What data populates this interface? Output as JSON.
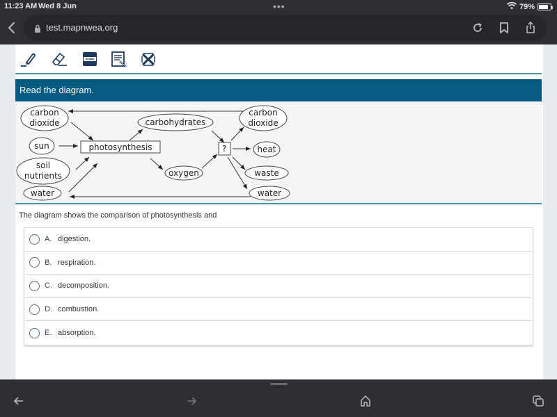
{
  "status_bar": {
    "time": "11:23 AM",
    "date": "Wed 8 Jun",
    "dots": "•••",
    "battery_percent": "79%",
    "battery_level": 0.79
  },
  "browser": {
    "url": "test.mapnwea.org",
    "icons": [
      "back-chevron-icon",
      "lock-icon",
      "reload-icon",
      "bookmark-icon",
      "share-icon"
    ]
  },
  "toolbar": {
    "tools": [
      {
        "name": "highlighter",
        "icon": "highlighter-icon"
      },
      {
        "name": "eraser",
        "icon": "eraser-icon"
      },
      {
        "name": "line-reader",
        "icon": "line-reader-icon"
      },
      {
        "name": "notepad",
        "icon": "notepad-icon"
      },
      {
        "name": "answer-eliminator",
        "icon": "answer-eliminator-icon"
      }
    ]
  },
  "prompt": {
    "banner_text": "Read the diagram."
  },
  "diagram": {
    "nodes": {
      "carbon_dioxide_in": [
        "carbon",
        "dioxide"
      ],
      "sun": "sun",
      "soil_nutrients": [
        "soil",
        "nutrients"
      ],
      "water_in": "water",
      "photosynthesis": "photosynthesis",
      "carbohydrates": "carbohydrates",
      "oxygen": "oxygen",
      "unknown": "?",
      "carbon_dioxide_out": [
        "carbon",
        "dioxide"
      ],
      "heat": "heat",
      "waste": "waste",
      "water_out": "water"
    }
  },
  "question": {
    "stem": "The diagram shows the comparison of photosynthesis and",
    "choices": [
      {
        "letter": "A.",
        "text": "digestion.",
        "selected": false
      },
      {
        "letter": "B.",
        "text": "respiration.",
        "selected": false
      },
      {
        "letter": "C.",
        "text": "decomposition.",
        "selected": false
      },
      {
        "letter": "D.",
        "text": "combustion.",
        "selected": false
      },
      {
        "letter": "E.",
        "text": "absorption.",
        "selected": false
      }
    ]
  },
  "bottom_bar": {
    "icons": [
      "back-arrow-icon",
      "forward-arrow-icon",
      "home-icon",
      "tabs-icon"
    ]
  },
  "colors": {
    "banner": "#055a82",
    "accent_line": "#4a90ad",
    "chrome": "#2e2f33",
    "toolbar_icon": "#1b3a5c"
  }
}
